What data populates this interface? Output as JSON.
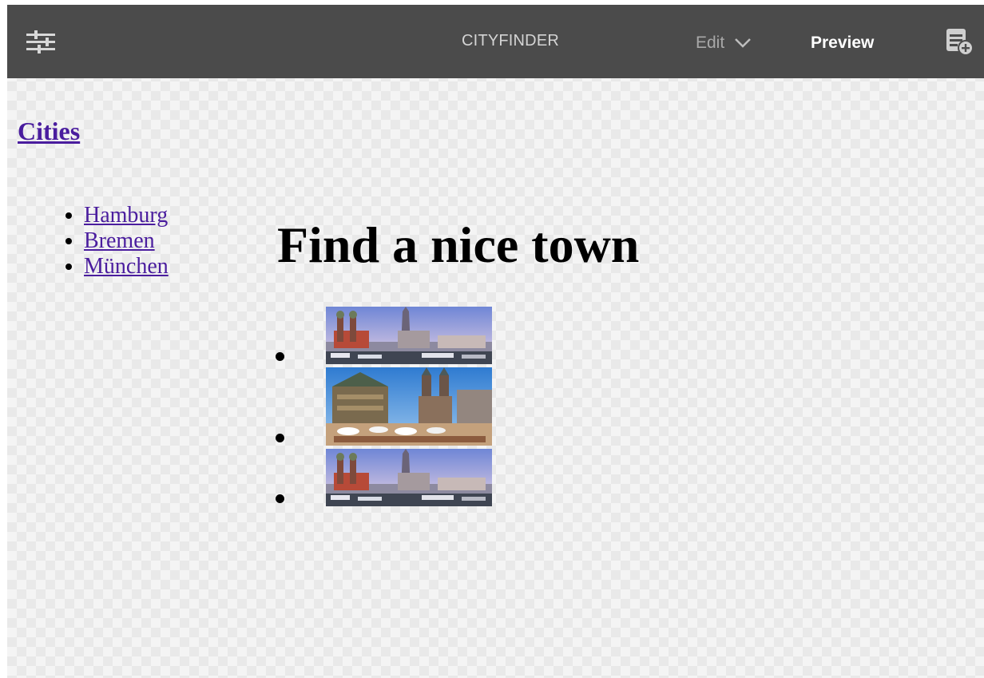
{
  "toolbar": {
    "settings_icon": "sliders-icon",
    "title": "CITYFINDER",
    "edit_label": "Edit",
    "preview_label": "Preview",
    "add_icon": "add-component-icon"
  },
  "sidebar": {
    "heading": "Cities",
    "items": [
      {
        "label": "Hamburg"
      },
      {
        "label": "Bremen"
      },
      {
        "label": "München"
      }
    ]
  },
  "main": {
    "heading": "Find a nice town",
    "images": [
      {
        "name": "munich-skyline-image"
      },
      {
        "name": "bremen-market-square-image"
      },
      {
        "name": "munich-skyline-image"
      }
    ]
  },
  "colors": {
    "toolbar_bg": "#4b4b4b",
    "link": "#4a1d9e"
  }
}
